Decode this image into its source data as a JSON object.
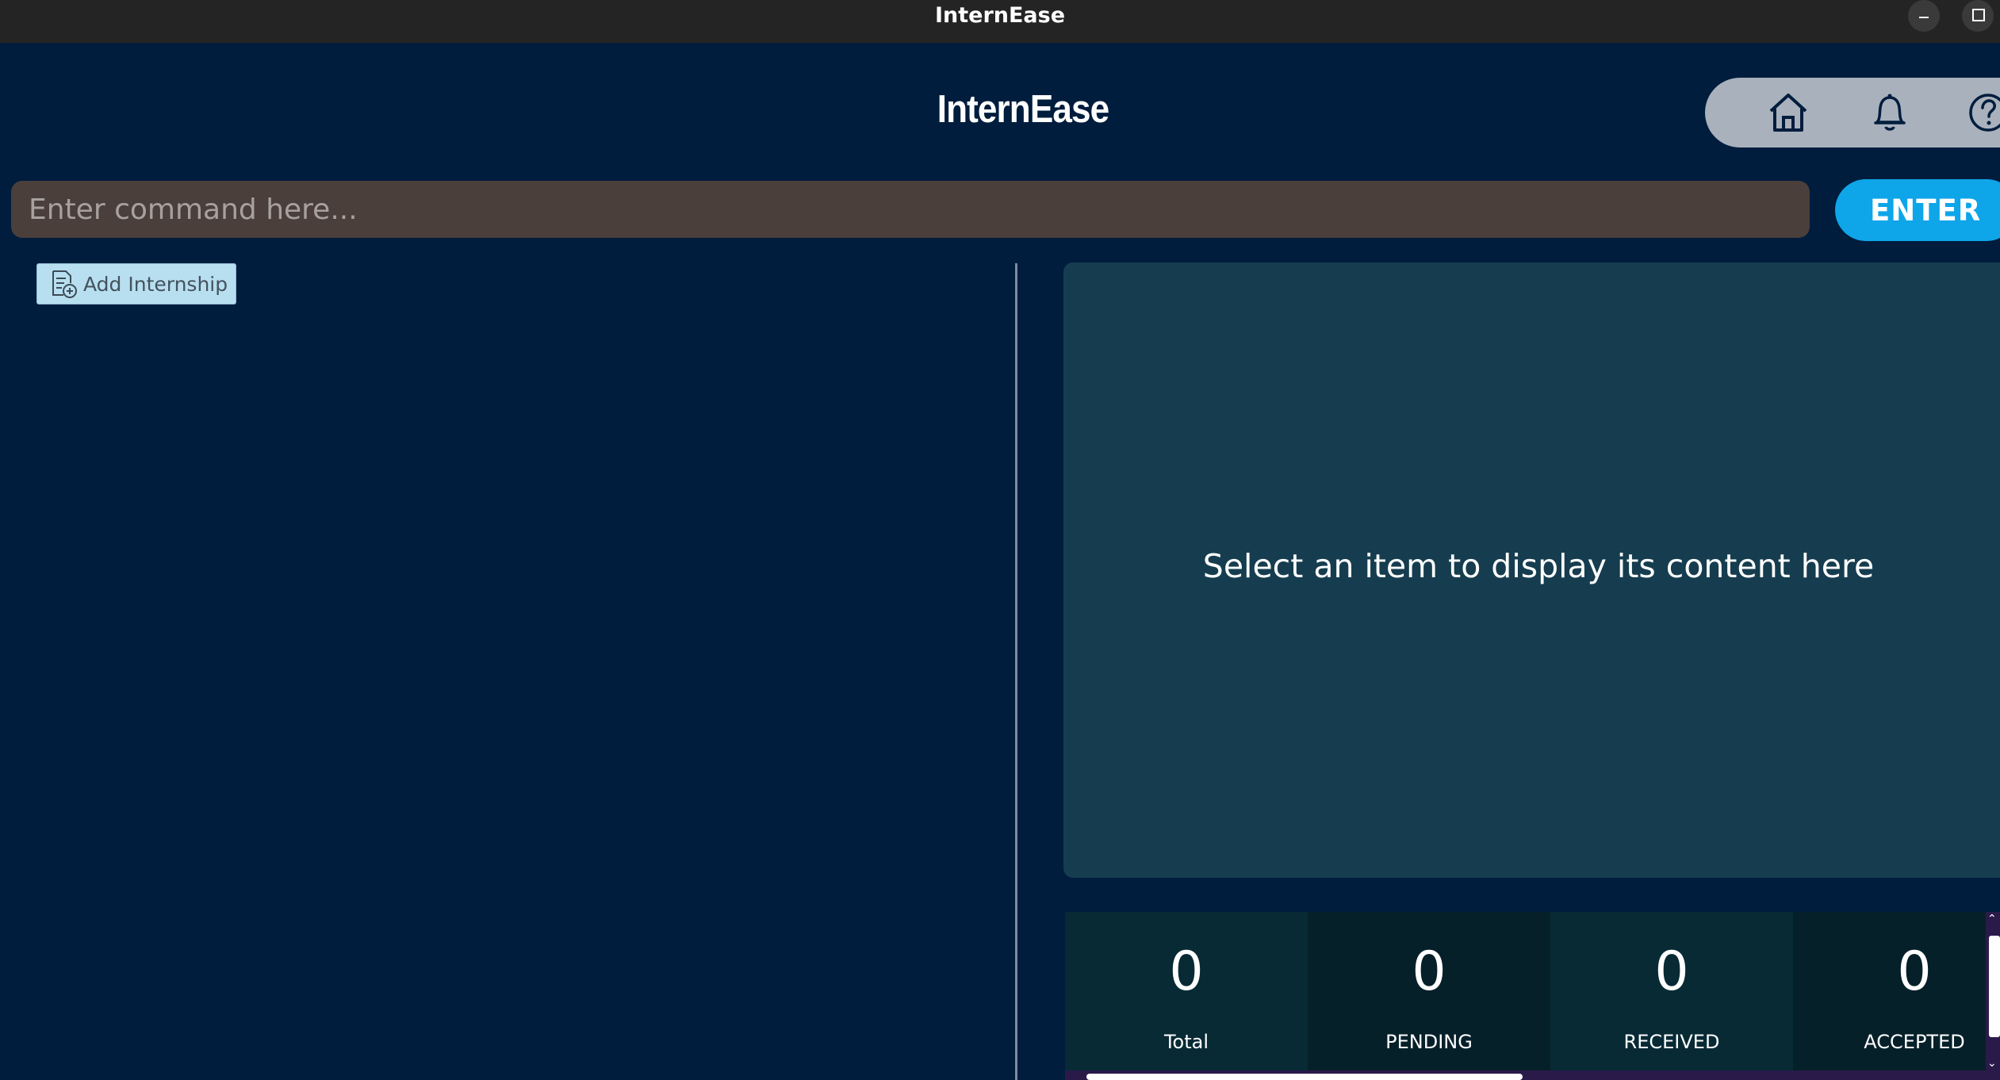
{
  "window": {
    "title": "InternEase"
  },
  "header": {
    "app_title": "InternEase",
    "nav": {
      "icons": [
        "home-icon",
        "bell-icon",
        "help-icon"
      ]
    }
  },
  "command": {
    "placeholder": "Enter command here...",
    "value": "",
    "enter_label": "ENTER"
  },
  "left_panel": {
    "add_button_label": "Add Internship"
  },
  "detail": {
    "message": "Select an item to display its content here"
  },
  "stats": [
    {
      "value": "0",
      "label": "Total"
    },
    {
      "value": "0",
      "label": "PENDING"
    },
    {
      "value": "0",
      "label": "RECEIVED"
    },
    {
      "value": "0",
      "label": "ACCEPTED"
    }
  ],
  "colors": {
    "background": "#001d3d",
    "accent": "#0ea5e9",
    "input_bg": "#4a3f3b",
    "detail_bg": "#163d4f"
  }
}
